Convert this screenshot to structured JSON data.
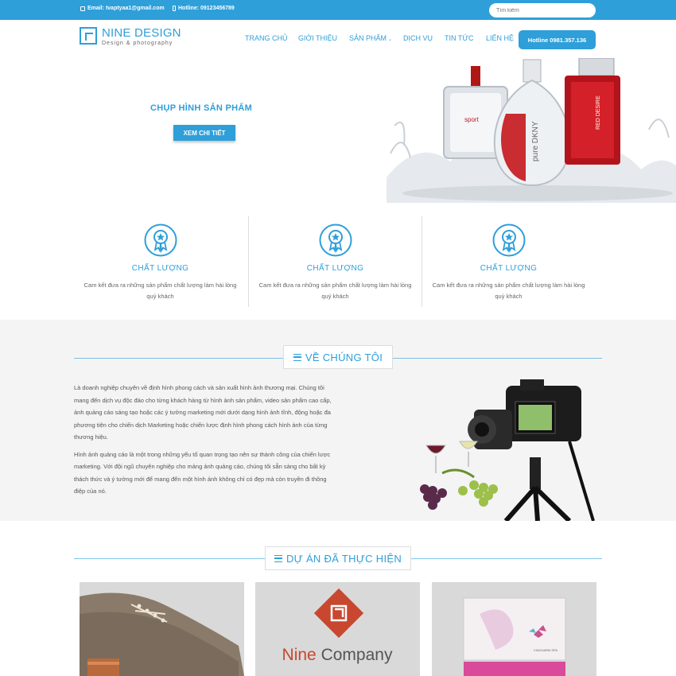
{
  "topbar": {
    "email": "Email: tvaptyaa1@gmail.com",
    "hotline": "Hotline: 09123456789",
    "search_placeholder": "Tìm kiếm"
  },
  "header": {
    "logo_name": "NINE DESIGN",
    "logo_tagline": "Design & photography",
    "nav": [
      "TRANG CHỦ",
      "GIỚI THIỆU",
      "SẢN PHẨM",
      "DỊCH VỤ",
      "TIN TỨC",
      "LIÊN HỆ"
    ],
    "hotline_button": "Hotline 0981.357.136"
  },
  "hero": {
    "title": "CHỤP HÌNH SẢN PHẨM",
    "button": "XEM CHI TIẾT"
  },
  "features": [
    {
      "title": "CHẤT LƯỢNG",
      "text": "Cam kết đưa ra những sản phẩm chất lượng làm hài lòng quý khách"
    },
    {
      "title": "CHẤT LƯỢNG",
      "text": "Cam kết đưa ra những sản phẩm chất lượng làm hài lòng quý khách"
    },
    {
      "title": "CHẤT LƯỢNG",
      "text": "Cam kết đưa ra những sản phẩm chất lượng làm hài lòng quý khách"
    }
  ],
  "about": {
    "title": "VỀ CHÚNG TÔI",
    "paragraphs": [
      "Là doanh nghiệp chuyên về định hình phong cách và sản xuất hình ảnh thương mại. Chúng tôi mang đến dịch vụ độc đáo cho từng khách hàng từ hình ảnh sản phẩm, video sản phẩm cao cấp, ảnh quảng cáo sáng tạo hoặc các ý tưởng marketing mới dưới dạng hình ảnh tĩnh, động hoặc đa phương tiện cho chiến dịch Marketing hoặc chiến lược định hình phong cách hình ảnh của từng thương hiệu.",
      "Hình ảnh quảng cáo là một trong những yếu tố quan trọng tạo nên sự thành công của chiến lược marketing. Với đội ngũ chuyên nghiệp cho mảng ảnh quảng cáo, chúng tôi sẵn sàng cho bất kỳ thách thức và ý tưởng mới để mang đến một hình ảnh không chỉ có đẹp mà còn truyền đi thông điệp của nó."
    ]
  },
  "projects": {
    "title": "DỰ ÁN ĐÃ THỰC HIỆN",
    "items": [
      {
        "name": "shoe-photo"
      },
      {
        "name": "nine-company-logo",
        "caption": "Nine Company"
      },
      {
        "name": "spa-card-photo",
        "caption": "VINCHARM SPA"
      }
    ]
  },
  "hero_bottles": [
    "sport",
    "pure DKNY",
    "RED DESIRE"
  ],
  "colors": {
    "primary": "#2e9fd9",
    "logo_red": "#c8472f"
  }
}
